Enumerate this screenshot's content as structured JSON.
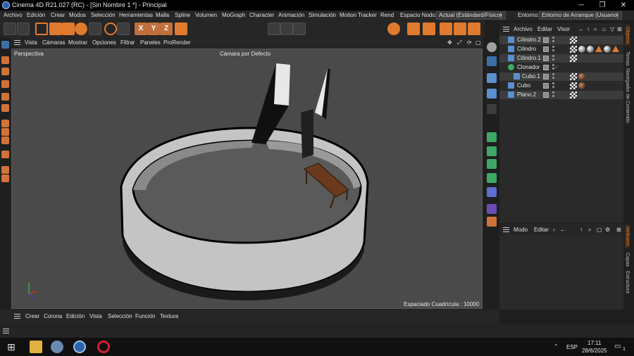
{
  "window": {
    "title": "Cinema 4D R21.027 (RC) - [Sin Nombre 1 *] - Principal",
    "minimize_icon": "minimize-icon",
    "maximize_icon": "restore-icon",
    "close_icon": "close-icon"
  },
  "menubar": {
    "items": [
      "Archivo",
      "Edición",
      "Crear",
      "Modos",
      "Selección",
      "Herramientas",
      "Malla",
      "Spline",
      "Volumen",
      "MoGraph",
      "Character",
      "Animación",
      "Simulación",
      "Motion Tracker",
      "Rend"
    ],
    "espacio_label": "Espacio Nodo:",
    "espacio_value": "Actual (Estándard/Físico)",
    "entorno_label": "Entorno:",
    "entorno_value": "Entorno de Arranque (Usuario)"
  },
  "toolbar": {
    "x_label": "X",
    "y_label": "Y",
    "z_label": "Z"
  },
  "viewport_menu": {
    "items": [
      "Vista",
      "Cámaras",
      "Mostrar",
      "Opciones",
      "Filtrar",
      "Paneles",
      "ProRender"
    ]
  },
  "viewport": {
    "view_name": "Perspectiva",
    "camera_label": "Cámara por Defecto",
    "grid_spacing": "Espaciado Cuadrícula : 10000 cm"
  },
  "object_manager": {
    "menu": [
      "Archivo",
      "Editar",
      "Visor"
    ],
    "objects": [
      {
        "name": "Cilindro.2",
        "indent": 0,
        "selected": true
      },
      {
        "name": "Cilindro",
        "indent": 0,
        "selected": false
      },
      {
        "name": "Cilindro.1",
        "indent": 0,
        "selected": true
      },
      {
        "name": "Clonador",
        "indent": 0,
        "selected": false
      },
      {
        "name": "Cubo.1",
        "indent": 1,
        "selected": true
      },
      {
        "name": "Cubo",
        "indent": 0,
        "selected": false
      },
      {
        "name": "Plano.2",
        "indent": 0,
        "selected": true
      }
    ]
  },
  "attribute_manager": {
    "menu": [
      "Modo",
      "Editar"
    ]
  },
  "right_tabs": {
    "items": [
      "Objetos",
      "Tomas",
      "Navegador de Contenido"
    ],
    "items_lower": [
      "Atributos",
      "Capas",
      "Estructura"
    ]
  },
  "material_bar": {
    "items": [
      "Crear",
      "Corona",
      "Edición",
      "Vista",
      "Selección",
      "Función",
      "Textura"
    ]
  },
  "taskbar": {
    "language": "ESP",
    "time": "17:11",
    "date": "28/6/2025",
    "notification_count": "1"
  }
}
